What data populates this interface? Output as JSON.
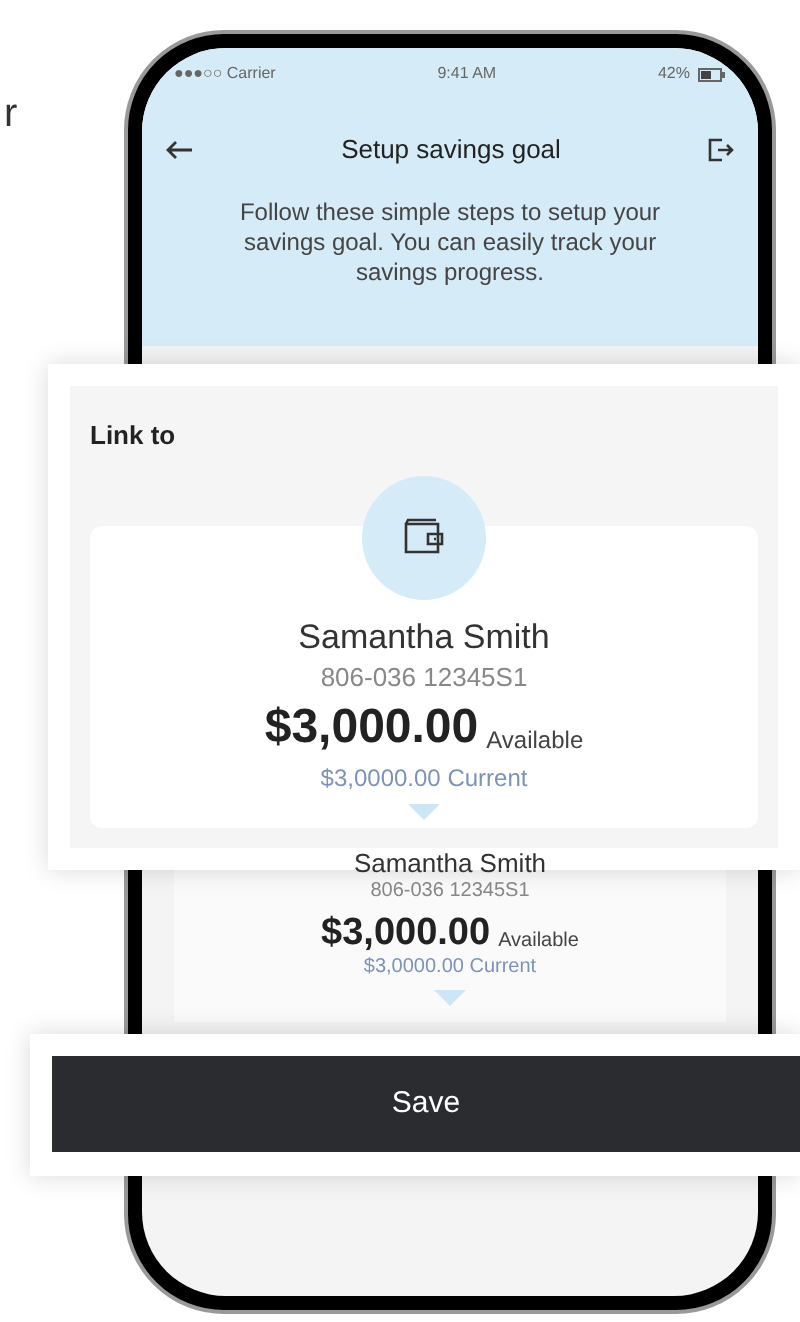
{
  "side_text": "r",
  "status_bar": {
    "carrier": "●●●○○ Carrier",
    "time": "9:41 AM",
    "battery": "42%"
  },
  "header": {
    "title": "Setup savings goal"
  },
  "description": "Follow these simple steps to setup your savings goal. You can easily track your savings progress.",
  "link_panel": {
    "heading": "Link to",
    "account": {
      "name": "Samantha Smith",
      "number": "806-036 12345S1",
      "balance": "$3,000.00",
      "balance_label": "Available",
      "current": "$3,0000.00 Current"
    }
  },
  "background_account": {
    "name": "Samantha Smith",
    "number": "806-036 12345S1",
    "balance": "$3,000.00",
    "balance_label": "Available",
    "current": "$3,0000.00 Current"
  },
  "save_button": "Save"
}
